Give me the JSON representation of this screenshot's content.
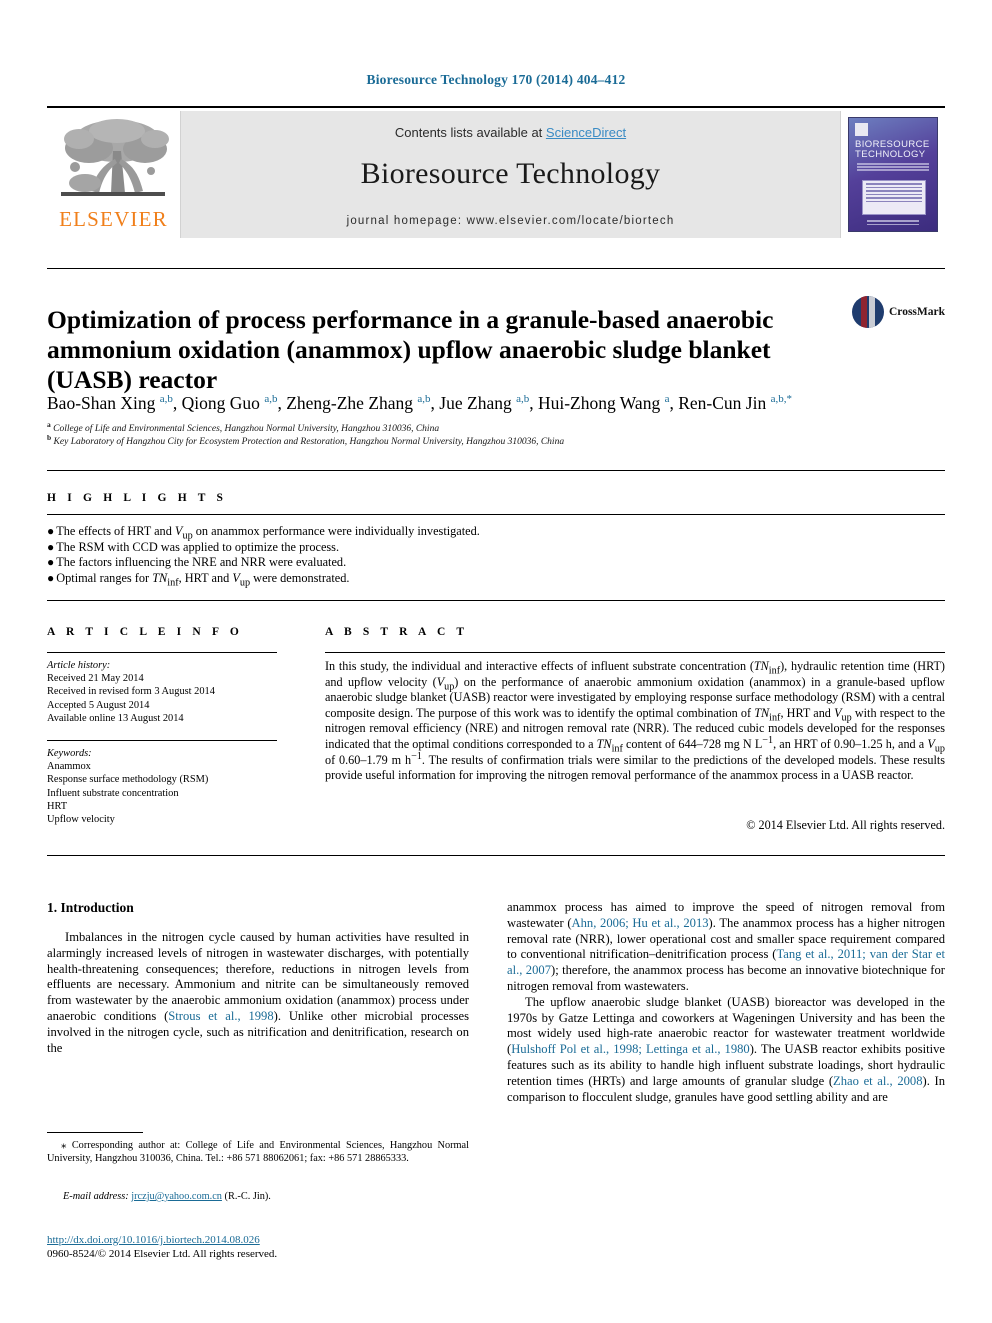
{
  "running_head": "Bioresource Technology 170 (2014) 404–412",
  "masthead": {
    "elsevier_wordmark": "ELSEVIER",
    "contents_prefix": "Contents lists available at ",
    "sciencedirect": "ScienceDirect",
    "journal_title": "Bioresource Technology",
    "homepage": "journal homepage: www.elsevier.com/locate/biortech",
    "cover_title_line1": "BIORESOURCE",
    "cover_title_line2": "TECHNOLOGY",
    "accent_orange": "#f07f1a",
    "link_blue": "#1a6b96"
  },
  "crossmark": {
    "label": "CrossMark"
  },
  "article": {
    "title": "Optimization of process performance in a granule-based anaerobic ammonium oxidation (anammox) upflow anaerobic sludge blanket (UASB) reactor",
    "authors_html": "Bao-Shan Xing <sup>a,b</sup>, Qiong Guo <sup>a,b</sup>, Zheng-Zhe Zhang <sup>a,b</sup>, Jue Zhang <sup>a,b</sup>, Hui-Zhong Wang <sup>a</sup>, Ren-Cun Jin <sup>a,b,</sup><sup>*</sup>",
    "affiliation_a": "College of Life and Environmental Sciences, Hangzhou Normal University, Hangzhou 310036, China",
    "affiliation_b": "Key Laboratory of Hangzhou City for Ecosystem Protection and Restoration, Hangzhou Normal University, Hangzhou 310036, China"
  },
  "highlights": {
    "heading": "H I G H L I G H T S",
    "items_html": [
      "The effects of HRT and <i>V</i><sub>up</sub> on anammox performance were individually investigated.",
      "The RSM with CCD was applied to optimize the process.",
      "The factors influencing the NRE and NRR were evaluated.",
      "Optimal ranges for <i>TN</i><sub>inf</sub>, HRT and <i>V</i><sub>up</sub> were demonstrated."
    ]
  },
  "article_info": {
    "heading": "A R T I C L E   I N F O",
    "history_label": "Article history:",
    "history": [
      "Received 21 May 2014",
      "Received in revised form 3 August 2014",
      "Accepted 5 August 2014",
      "Available online 13 August 2014"
    ],
    "keywords_label": "Keywords:",
    "keywords": [
      "Anammox",
      "Response surface methodology (RSM)",
      "Influent substrate concentration",
      "HRT",
      "Upflow velocity"
    ]
  },
  "abstract": {
    "heading": "A B S T R A C T",
    "text_html": "In this study, the individual and interactive effects of influent substrate concentration (<i>TN</i><sub>inf</sub>), hydraulic retention time (HRT) and upflow velocity (<i>V</i><sub>up</sub>) on the performance of anaerobic ammonium oxidation (anammox) in a granule-based upflow anaerobic sludge blanket (UASB) reactor were investigated by employing response surface methodology (RSM) with a central composite design. The purpose of this work was to identify the optimal combination of <i>TN</i><sub>inf</sub>, HRT and <i>V</i><sub>up</sub> with respect to the nitrogen removal efficiency (NRE) and nitrogen removal rate (NRR). The reduced cubic models developed for the responses indicated that the optimal conditions corresponded to a <i>TN</i><sub>inf</sub> content of 644–728 mg N L<sup>&minus;1</sup>, an HRT of 0.90–1.25 h, and a <i>V</i><sub>up</sub> of 0.60–1.79 m h<sup>&minus;1</sup>. The results of confirmation trials were similar to the predictions of the developed models. These results provide useful information for improving the nitrogen removal performance of the anammox process in a UASB reactor.",
    "copyright": "© 2014 Elsevier Ltd. All rights reserved."
  },
  "body": {
    "section_title": "1. Introduction",
    "left_paragraphs_html": [
      "Imbalances in the nitrogen cycle caused by human activities have resulted in alarmingly increased levels of nitrogen in wastewater discharges, with potentially health-threatening consequences; therefore, reductions in nitrogen levels from effluents are necessary. Ammonium and nitrite can be simultaneously removed from wastewater by the anaerobic ammonium oxidation (anammox) process under anaerobic conditions (<span class=\"ref\">Strous et al., 1998</span>). Unlike other microbial processes involved in the nitrogen cycle, such as nitrification and denitrification, research on the"
    ],
    "right_paragraphs_html": [
      "anammox process has aimed to improve the speed of nitrogen removal from wastewater (<span class=\"ref\">Ahn, 2006; Hu et al., 2013</span>). The anammox process has a higher nitrogen removal rate (NRR), lower operational cost and smaller space requirement compared to conventional nitrification–denitrification process (<span class=\"ref\">Tang et al., 2011; van der Star et al., 2007</span>); therefore, the anammox process has become an innovative biotechnique for nitrogen removal from wastewaters.",
      "The upflow anaerobic sludge blanket (UASB) bioreactor was developed in the 1970s by Gatze Lettinga and coworkers at Wageningen University and has been the most widely used high-rate anaerobic reactor for wastewater treatment worldwide (<span class=\"ref\">Hulshoff Pol et al., 1998; Lettinga et al., 1980</span>). The UASB reactor exhibits positive features such as its ability to handle high influent substrate loadings, short hydraulic retention times (HRTs) and large amounts of granular sludge (<span class=\"ref\">Zhao et al., 2008</span>). In comparison to flocculent sludge, granules have good settling ability and are"
    ]
  },
  "footnote": {
    "corresponding_html": "<span style=\"font-size:11px\">⁎</span> Corresponding author at: College of Life and Environmental Sciences, Hangzhou Normal University, Hangzhou 310036, China. Tel.: +86 571 88062061; fax: +86 571 28865333.",
    "email_label": "E-mail address:",
    "email": "jrczju@yahoo.com.cn",
    "email_owner": "(R.-C. Jin).",
    "doi": "http://dx.doi.org/10.1016/j.biortech.2014.08.026",
    "issn_line": "0960-8524/© 2014 Elsevier Ltd. All rights reserved."
  }
}
